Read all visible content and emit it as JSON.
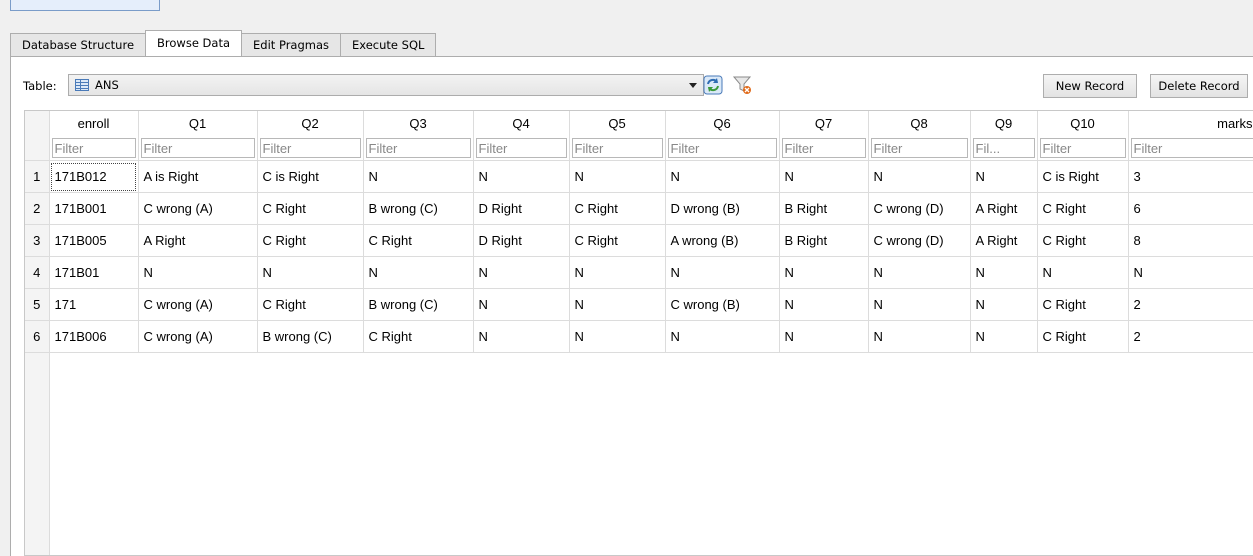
{
  "tabs": [
    {
      "label": "Database Structure",
      "active": false
    },
    {
      "label": "Browse Data",
      "active": true
    },
    {
      "label": "Edit Pragmas",
      "active": false
    },
    {
      "label": "Execute SQL",
      "active": false
    }
  ],
  "toolbar": {
    "table_label": "Table:",
    "table_value": "ANS",
    "table_icon": "table-icon",
    "refresh_icon": "refresh-icon",
    "clear_filters_icon": "clear-filters-icon",
    "new_record_label": "New Record",
    "delete_record_label": "Delete Record"
  },
  "grid": {
    "columns": [
      "enroll",
      "Q1",
      "Q2",
      "Q3",
      "Q4",
      "Q5",
      "Q6",
      "Q7",
      "Q8",
      "Q9",
      "Q10",
      "marks"
    ],
    "filter_placeholders": [
      "Filter",
      "Filter",
      "Filter",
      "Filter",
      "Filter",
      "Filter",
      "Filter",
      "Filter",
      "Filter",
      "Fil...",
      "Filter",
      "Filter"
    ],
    "rows": [
      {
        "num": "1",
        "cells": [
          "171B012",
          "A is Right",
          "C is Right",
          "N",
          "N",
          "N",
          "N",
          "N",
          "N",
          "N",
          "C is Right",
          "3"
        ]
      },
      {
        "num": "2",
        "cells": [
          "171B001",
          "C wrong (A)",
          "C Right",
          "B wrong (C)",
          "D Right",
          "C Right",
          "D wrong (B)",
          "B Right",
          "C wrong (D)",
          "A Right",
          "C Right",
          "6"
        ]
      },
      {
        "num": "3",
        "cells": [
          "171B005",
          "A Right",
          "C Right",
          "C Right",
          "D Right",
          "C Right",
          "A wrong (B)",
          "B Right",
          "C wrong (D)",
          "A Right",
          "C Right",
          "8"
        ]
      },
      {
        "num": "4",
        "cells": [
          "171B01",
          "N",
          "N",
          "N",
          "N",
          "N",
          "N",
          "N",
          "N",
          "N",
          "N",
          "N"
        ]
      },
      {
        "num": "5",
        "cells": [
          "171",
          "C wrong (A)",
          "C Right",
          "B wrong (C)",
          "N",
          "N",
          "C wrong (B)",
          "N",
          "N",
          "N",
          "C Right",
          "2"
        ]
      },
      {
        "num": "6",
        "cells": [
          "171B006",
          "C wrong (A)",
          "B wrong (C)",
          "C Right",
          "N",
          "N",
          "N",
          "N",
          "N",
          "N",
          "C Right",
          "2"
        ]
      }
    ]
  }
}
